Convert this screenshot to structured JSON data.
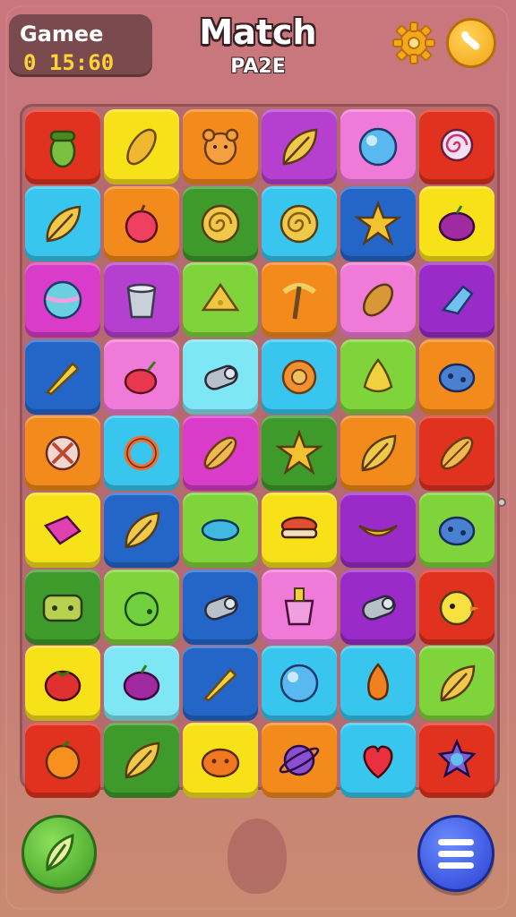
{
  "header": {
    "score_label": "Gamee",
    "score_value": "0 15:60",
    "title": "Match",
    "subtitle": "PA2E"
  },
  "colors": {
    "red": "#e0321e",
    "yellow": "#f7e21a",
    "orange": "#f28a1c",
    "purple": "#b540d0",
    "pink": "#f07ad8",
    "cyan": "#38c6ee",
    "blue": "#2466c8",
    "green": "#3f9a2c",
    "lime": "#7fd43c",
    "violet": "#9a2bc8",
    "light_cyan": "#7ee6f4",
    "magenta": "#d83cc8"
  },
  "board": {
    "rows": [
      [
        {
          "color": "red",
          "icon": "acorn-icon"
        },
        {
          "color": "yellow",
          "icon": "corn-icon"
        },
        {
          "color": "orange",
          "icon": "bear-icon"
        },
        {
          "color": "purple",
          "icon": "leaf-icon"
        },
        {
          "color": "pink",
          "icon": "orb-icon"
        },
        {
          "color": "red",
          "icon": "lollipop-icon"
        }
      ],
      [
        {
          "color": "cyan",
          "icon": "leaf-icon"
        },
        {
          "color": "orange",
          "icon": "apple-icon"
        },
        {
          "color": "green",
          "icon": "swirl-icon"
        },
        {
          "color": "cyan",
          "icon": "swirl-icon"
        },
        {
          "color": "blue",
          "icon": "star-icon"
        },
        {
          "color": "yellow",
          "icon": "berry-icon"
        }
      ],
      [
        {
          "color": "magenta",
          "icon": "ball-icon"
        },
        {
          "color": "purple",
          "icon": "bucket-icon"
        },
        {
          "color": "lime",
          "icon": "cheese-icon"
        },
        {
          "color": "orange",
          "icon": "pickaxe-icon"
        },
        {
          "color": "pink",
          "icon": "pinecone-icon"
        },
        {
          "color": "violet",
          "icon": "crystal-icon"
        }
      ],
      [
        {
          "color": "blue",
          "icon": "carrot-icon"
        },
        {
          "color": "pink",
          "icon": "cherry-icon"
        },
        {
          "color": "light_cyan",
          "icon": "log-icon"
        },
        {
          "color": "cyan",
          "icon": "flower-icon"
        },
        {
          "color": "lime",
          "icon": "pear-icon"
        },
        {
          "color": "orange",
          "icon": "stone-icon"
        }
      ],
      [
        {
          "color": "orange",
          "icon": "tools-icon"
        },
        {
          "color": "cyan",
          "icon": "pretzel-icon"
        },
        {
          "color": "magenta",
          "icon": "feather-icon"
        },
        {
          "color": "green",
          "icon": "star-icon"
        },
        {
          "color": "orange",
          "icon": "leaf-icon"
        },
        {
          "color": "red",
          "icon": "feather-icon"
        }
      ],
      [
        {
          "color": "yellow",
          "icon": "gem-icon"
        },
        {
          "color": "blue",
          "icon": "leaf-icon"
        },
        {
          "color": "lime",
          "icon": "fish-icon"
        },
        {
          "color": "yellow",
          "icon": "burger-icon"
        },
        {
          "color": "violet",
          "icon": "banana-icon"
        },
        {
          "color": "lime",
          "icon": "stone-icon"
        }
      ],
      [
        {
          "color": "green",
          "icon": "gamepad-icon"
        },
        {
          "color": "lime",
          "icon": "lime-icon"
        },
        {
          "color": "blue",
          "icon": "log-icon"
        },
        {
          "color": "pink",
          "icon": "cup-icon"
        },
        {
          "color": "violet",
          "icon": "log-icon"
        },
        {
          "color": "red",
          "icon": "chick-icon"
        }
      ],
      [
        {
          "color": "yellow",
          "icon": "tomato-icon"
        },
        {
          "color": "light_cyan",
          "icon": "berry-icon"
        },
        {
          "color": "blue",
          "icon": "carrot-icon"
        },
        {
          "color": "cyan",
          "icon": "orb-icon"
        },
        {
          "color": "cyan",
          "icon": "flame-icon"
        },
        {
          "color": "lime",
          "icon": "leaf-icon"
        }
      ],
      [
        {
          "color": "red",
          "icon": "orange-icon"
        },
        {
          "color": "green",
          "icon": "leaf-icon"
        },
        {
          "color": "yellow",
          "icon": "pumpkin-icon"
        },
        {
          "color": "orange",
          "icon": "planet-icon"
        },
        {
          "color": "cyan",
          "icon": "heart-icon"
        },
        {
          "color": "red",
          "icon": "shell-icon"
        }
      ]
    ]
  },
  "buttons": {
    "settings_icon": "gear-icon",
    "sound_icon": "sound-icon",
    "hint_icon": "leaf-icon",
    "menu_icon": "menu-icon"
  }
}
